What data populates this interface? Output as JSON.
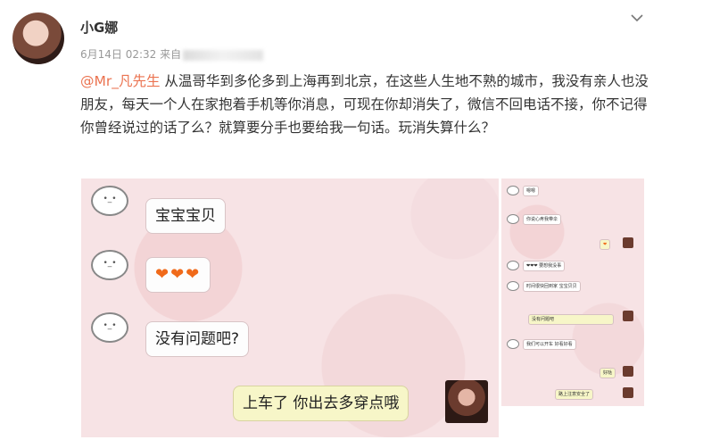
{
  "user": {
    "name": "小G娜",
    "date": "6月14日 02:32 来自"
  },
  "post": {
    "mention": "@Mr_凡先生",
    "text": " 从温哥华到多伦多到上海再到北京，在这些人生地不熟的城市，我没有亲人也没朋友，每天一个人在家抱着手机等你消息，可现在你却消失了，微信不回电话不接，你不记得你曾经说过的话了么？就算要分手也要给我一句话。玩消失算什么？"
  },
  "chat": {
    "m1": "宝宝宝贝",
    "m2_hearts": "❤❤❤",
    "m3": "没有问题吧?",
    "reply": "上车了 你出去多穿点哦"
  },
  "side_chat": {
    "s1": "嗯嗯",
    "s2": "你说心疼我带伞",
    "s3": "❤",
    "s4": "❤❤❤ 要想我没事",
    "s5": "时间很快回到家 宝宝贝贝",
    "s6": "没有问题吧",
    "s7": "我们可以开车 好看好看",
    "s8": "好哒",
    "s9": "路上注意安全了"
  },
  "colors": {
    "mention": "#eb7350",
    "panel_bg": "#f7e3e5",
    "heart": "#f06a1a"
  },
  "icons": {
    "expand": "chevron-down-icon"
  }
}
